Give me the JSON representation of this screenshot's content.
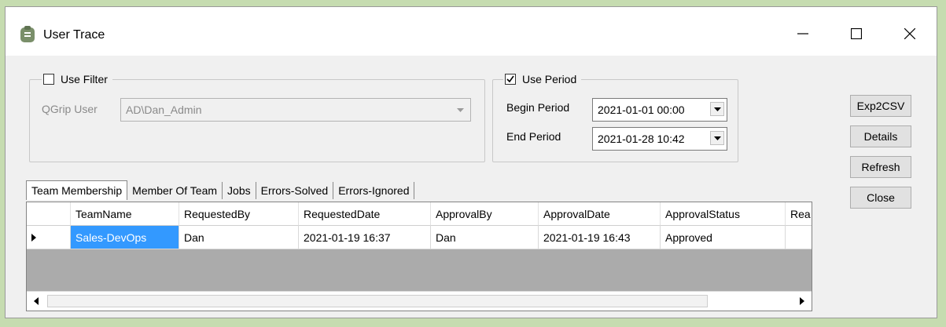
{
  "window": {
    "title": "User Trace"
  },
  "filter": {
    "checkbox_label": "Use Filter",
    "checked": false,
    "user_label": "QGrip User",
    "user_value": "AD\\Dan_Admin"
  },
  "period": {
    "checkbox_label": "Use Period",
    "checked": true,
    "begin_label": "Begin Period",
    "begin_value": "2021-01-01 00:00",
    "end_label": "End Period",
    "end_value": "2021-01-28 10:42"
  },
  "buttons": {
    "export": "Exp2CSV",
    "details": "Details",
    "refresh": "Refresh",
    "close": "Close"
  },
  "tabs": [
    "Team Membership",
    "Member Of Team",
    "Jobs",
    "Errors-Solved",
    "Errors-Ignored"
  ],
  "table": {
    "columns": [
      "TeamName",
      "RequestedBy",
      "RequestedDate",
      "ApprovalBy",
      "ApprovalDate",
      "ApprovalStatus",
      "Rea"
    ],
    "rows": [
      [
        "Sales-DevOps",
        "Dan",
        "2021-01-19 16:37",
        "Dan",
        "2021-01-19 16:43",
        "Approved",
        ""
      ]
    ]
  }
}
